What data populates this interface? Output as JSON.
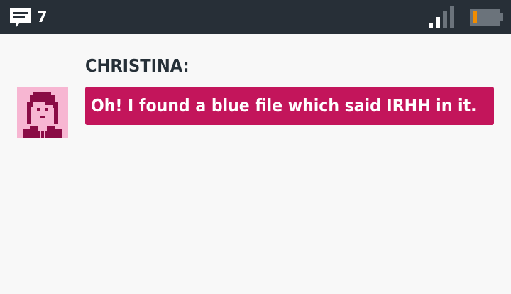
{
  "status_bar": {
    "message_icon": "chat-bubble-icon",
    "message_count": "7",
    "signal_icon": "signal-strength-icon",
    "signal_level": 0.5,
    "battery_icon": "battery-icon",
    "battery_level": 0.15,
    "colors": {
      "background": "#272f37",
      "battery_fill": "#f08c00"
    }
  },
  "dialogue": {
    "speaker": "CHRISTINA:",
    "avatar_icon": "christina-portrait-avatar",
    "message": "Oh! I found a blue file which said IRHH in it.",
    "colors": {
      "bubble": "#c3155b",
      "speaker_text": "#263038",
      "avatar_bg": "#f7b6d2"
    }
  }
}
